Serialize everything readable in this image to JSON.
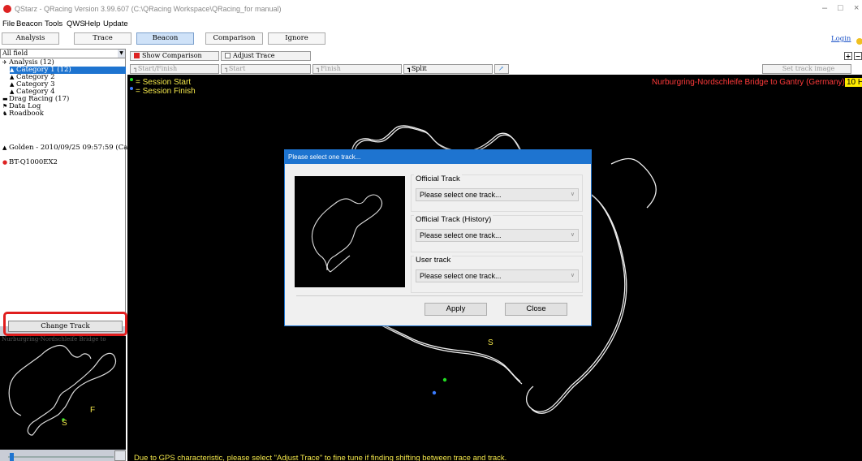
{
  "window": {
    "title": "QStarz - QRacing Version 3.99.607 (C:\\QRacing Workspace\\QRacing_for manual)"
  },
  "menu": [
    "File",
    "Beacon",
    "Tools",
    "QWS",
    "Help",
    "Update"
  ],
  "tabs": {
    "analysis": "Analysis",
    "trace": "Trace",
    "beacon": "Beacon",
    "comparison": "Comparison",
    "ignore": "Ignore",
    "login": "Login"
  },
  "sidebar": {
    "field_select": "All field",
    "tree": {
      "analysis": "Analysis (12)",
      "category1": "Category 1 (12)",
      "category2": "Category 2",
      "category3": "Category 3",
      "category4": "Category 4",
      "drag_racing": "Drag Racing (17)",
      "data_log": "Data Log",
      "roadbook": "Roadbook",
      "golden": "Golden - 2010/09/25 09:57:59 (Categ",
      "device": "BT-Q1000EX2"
    },
    "change_track": "Change Track",
    "thumb_label": "Nurburgring-Nordschleife Bridge to"
  },
  "subtoolbar": {
    "show_comparison": "Show Comparison",
    "adjust_trace": "Adjust Trace",
    "start_finish": "Start/Finish",
    "start": "Start",
    "finish": "Finish",
    "split": "Split",
    "set_track_image": "Set track image"
  },
  "canvas": {
    "legend_start": "= Session Start",
    "legend_finish": "= Session Finish",
    "track_name": "Nurburgring-Nordschleife Bridge to Gantry (Germany)",
    "hz_badge": "10 Hz",
    "status_message": "Due to GPS characteristic, please select \"Adjust Trace\" to fine tune if finding shifting between trace and track.",
    "marker_s": "S",
    "marker_f": "F"
  },
  "dialog": {
    "title": "Please select one track...",
    "official_track_label": "Official Track",
    "official_track_value": "Please select one track...",
    "official_history_label": "Official Track (History)",
    "official_history_value": "Please select one track...",
    "user_track_label": "User track",
    "user_track_value": "Please select one track...",
    "apply": "Apply",
    "close": "Close"
  },
  "colors": {
    "accent_blue": "#1e74d0",
    "highlight_red": "#e01e1e",
    "legend_yellow": "#f2e64a",
    "track_name_red": "#ff3a3a",
    "session_start": "#22dd22",
    "session_finish": "#3a7bff"
  }
}
